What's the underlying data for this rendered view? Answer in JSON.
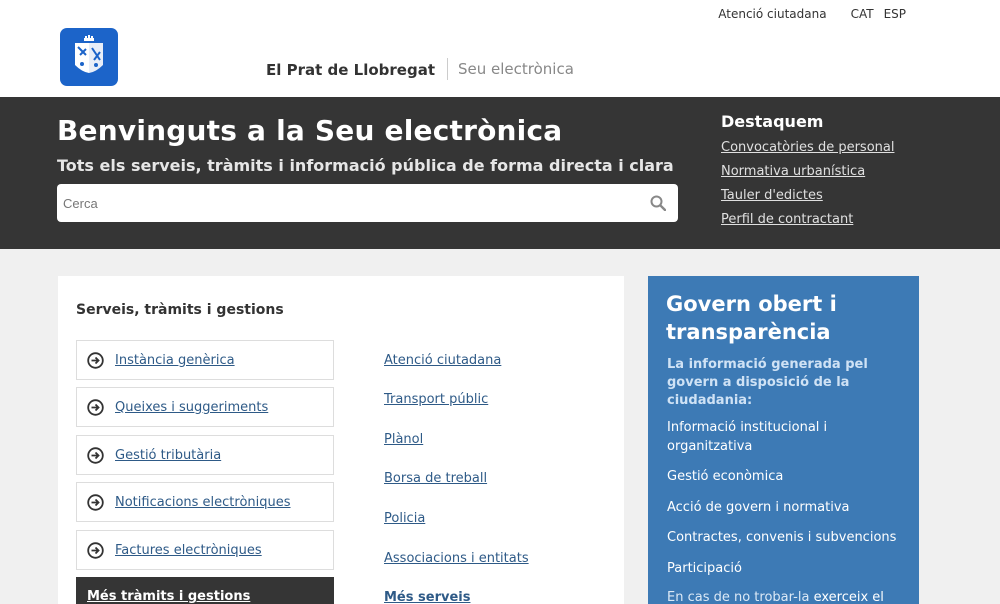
{
  "header": {
    "atencio": "Atenció ciutadana",
    "lang_cat": "CAT",
    "lang_esp": "ESP",
    "site_name": "El Prat de Llobregat",
    "seu_name": "Seu electrònica"
  },
  "banner": {
    "title": "Benvinguts a la Seu electrònica",
    "subtitle": "Tots els serveis, tràmits i informació pública de forma directa i clara",
    "search_placeholder": "Cerca",
    "highlights_title": "Destaquem",
    "highlights": [
      "Convocatòries de personal",
      "Normativa urbanística",
      "Tauler d'edictes",
      "Perfil de contractant"
    ]
  },
  "services": {
    "title": "Serveis, tràmits i gestions",
    "procedures": [
      "Instància genèrica",
      "Queixes i suggeriments",
      "Gestió tributària",
      "Notificacions electròniques",
      "Factures electròniques"
    ],
    "more_procedures": "Més tràmits i gestions",
    "links": [
      "Atenció ciutadana",
      "Transport públic",
      "Plànol",
      "Borsa de treball",
      "Policia",
      "Associacions i entitats"
    ],
    "more_services": "Més serveis"
  },
  "gov": {
    "title": "Govern obert i transparència",
    "intro": "La informació generada pel govern a disposició de la ciudadania:",
    "links": [
      "Informació institucional i organitzativa",
      "Gestió econòmica",
      "Acció de govern i normativa",
      "Contractes, convenis i subvencions",
      "Participació"
    ],
    "footer_prefix": "En cas de no trobar-la",
    "footer_link": "exerceix el"
  },
  "colors": {
    "banner_bg": "#353535",
    "logo_blue": "#1c64c9",
    "gov_blue": "#3d7ab5",
    "link": "#2e5a87"
  },
  "icons": {
    "search": "search-icon",
    "arrow": "arrow-circle-right-icon",
    "logo": "coat-of-arms-logo"
  }
}
